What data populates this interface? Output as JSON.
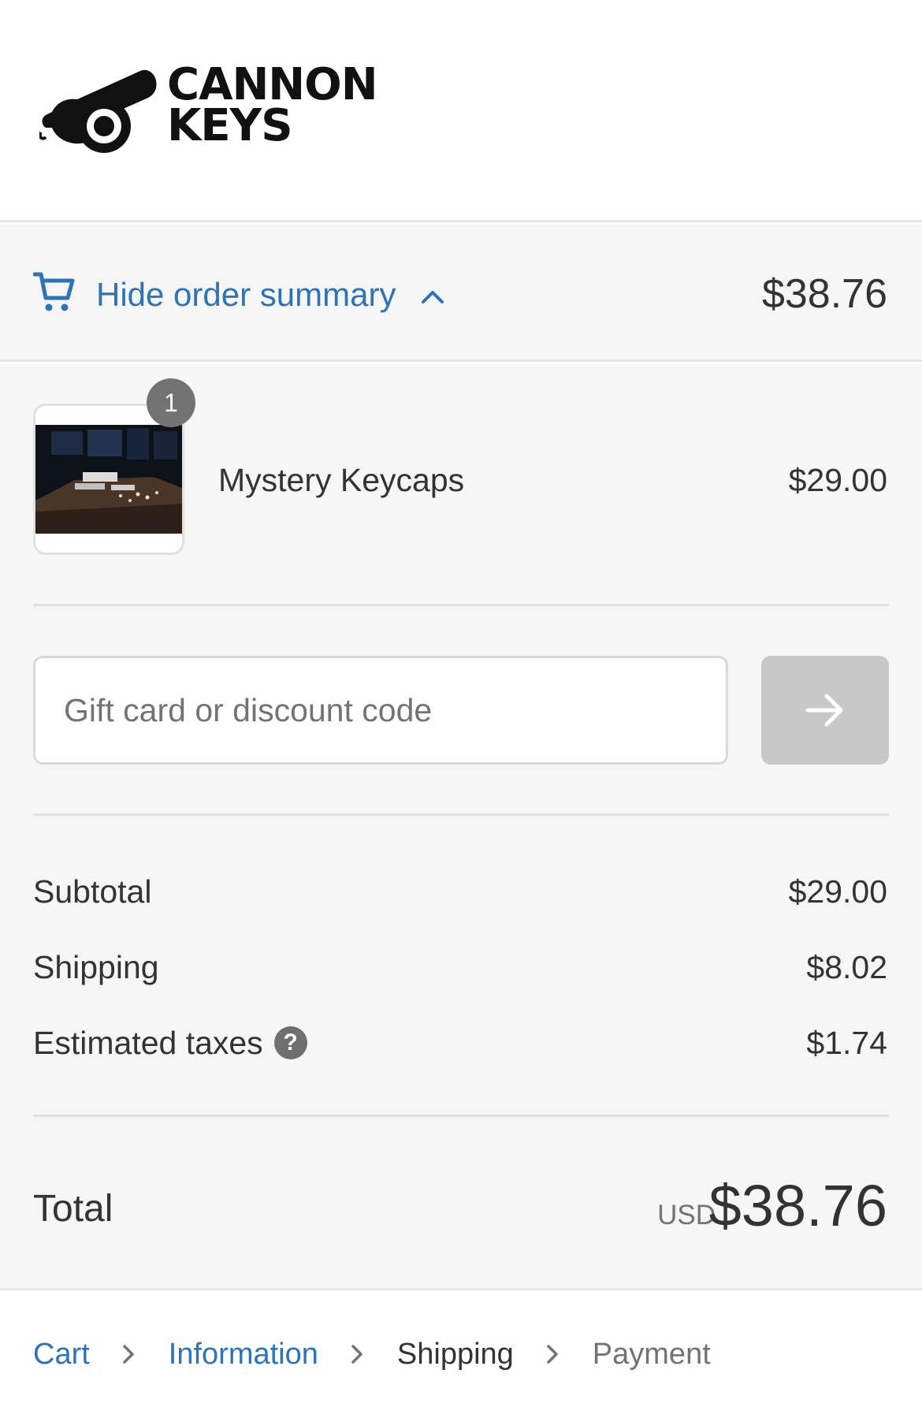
{
  "brand": {
    "logo_line1": "CANNON",
    "logo_line2": "KEYS"
  },
  "order_summary_toggle": {
    "label": "Hide order summary",
    "total": "$38.76",
    "icons": [
      "cart-icon",
      "chevron-up-icon"
    ]
  },
  "line_items": [
    {
      "quantity": "1",
      "name": "Mystery Keycaps",
      "price": "$29.00"
    }
  ],
  "discount": {
    "placeholder": "Gift card or discount code",
    "value": "",
    "apply_icon": "arrow-right-icon"
  },
  "costs": {
    "subtotal_label": "Subtotal",
    "subtotal_value": "$29.00",
    "shipping_label": "Shipping",
    "shipping_value": "$8.02",
    "taxes_label": "Estimated taxes",
    "taxes_help": "?",
    "taxes_value": "$1.74"
  },
  "total": {
    "label": "Total",
    "currency": "USD",
    "value": "$38.76"
  },
  "breadcrumb": {
    "items": [
      {
        "label": "Cart",
        "state": "link"
      },
      {
        "label": "Information",
        "state": "link"
      },
      {
        "label": "Shipping",
        "state": "current"
      },
      {
        "label": "Payment",
        "state": "upcoming"
      }
    ]
  },
  "colors": {
    "accent": "#2f73b5",
    "panel_background": "#f6f6f6",
    "text": "#333333",
    "muted_text": "#737373",
    "badge": "#737373",
    "apply_button_disabled": "#c8c8c8"
  }
}
